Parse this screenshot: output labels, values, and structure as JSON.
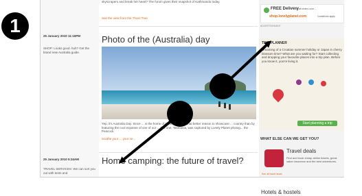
{
  "badge": {
    "number": "1"
  },
  "left_column": {
    "date1": "25 January 2010 11:15PM",
    "note1": "SHOP: Looks good. huh? Get the brand new Australia guide.",
    "date2": "25 January 2010 5:34AM",
    "note2": "TRAVEL SERVICES: We can sort you out with tents and"
  },
  "main": {
    "top_text": "skyscrapers and break her heart? The forum gives their snapshot of Kathmandu today.",
    "top_link": "See the view from the Thorn Tree",
    "post1_title": "Photo of the (Australia) day",
    "post1_caption": "Yep, it's Australia Day. Since ... is the home of Lonely Planet, what better reason to showcase ... country than by featuring the cool expanse of one of our ... this one, Tasmania, was captured by Lonely Planet photog... the Peacock.",
    "post1_link": "Soothe your ... your ne...",
    "post2_title": "Home camping: the future of travel?"
  },
  "sidebar": {
    "free_delivery": "FREE Delivery",
    "delivery_note": "on all orders over...",
    "shop_url": "shop.lonelyplanet.com",
    "shop_sub": "Conditions apply",
    "advertisement": "ADVERTISEMENT",
    "trip_heading": "TRIP PLANNER",
    "trip_text": "Dreaming of a Croatian summer holiday or Japan in cherry blossom time? What are you waiting for? Start collecting and dropping your favourite places into a trip plan. Before you know it, you're living it.",
    "start_button": "Start planning a trip",
    "what_else": "WHAT ELSE CAN WE GET YOU?",
    "travel_deals_title": "Travel deals",
    "travel_deals_text": "Find and book cheap airline tickets, great-value insurance and the best adventures.",
    "see_all": "See all travel deals",
    "hotels": "Hotels & hostels"
  }
}
